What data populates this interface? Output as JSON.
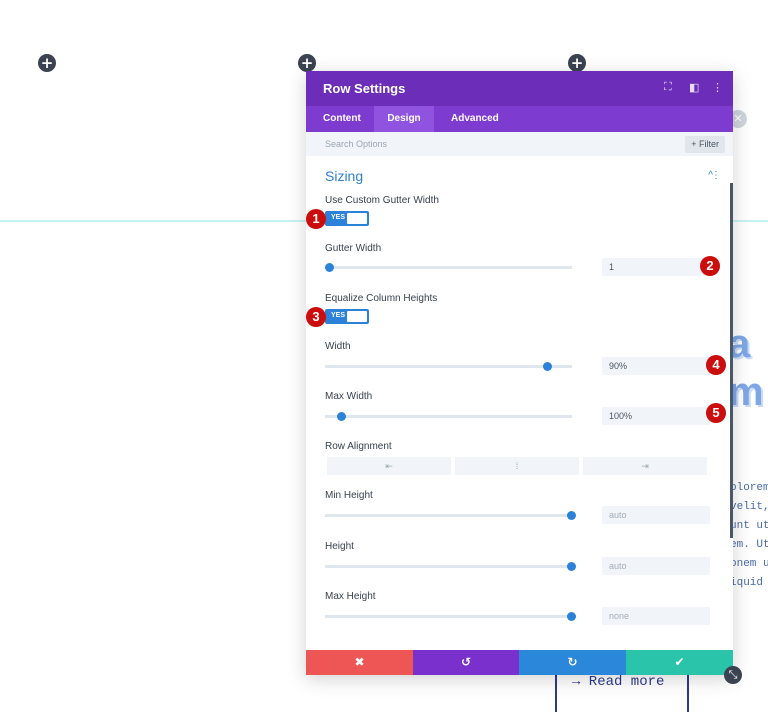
{
  "page": {
    "plus_icon": "+",
    "background_big": [
      "a",
      "m"
    ],
    "background_text": [
      "olorem",
      " velit,",
      "unt ut",
      "em. Ut",
      "onem ul",
      "iquid e"
    ],
    "read_more": "→ Read more"
  },
  "modal": {
    "title": "Row Settings",
    "header_icons": {
      "expand": "⛶",
      "split": "◧",
      "more": "⋮"
    },
    "tabs": [
      {
        "label": "Content",
        "active": false
      },
      {
        "label": "Design",
        "active": true
      },
      {
        "label": "Advanced",
        "active": false
      }
    ],
    "search_placeholder": "Search Options",
    "filter_label": "+ Filter",
    "section": {
      "title": "Sizing",
      "caret": "^",
      "dots": "⋮"
    },
    "fields": {
      "custom_gutter": {
        "label": "Use Custom Gutter Width",
        "value": "YES"
      },
      "gutter_width": {
        "label": "Gutter Width",
        "value": "1",
        "level": 0.0
      },
      "equalize": {
        "label": "Equalize Column Heights",
        "value": "YES"
      },
      "width": {
        "label": "Width",
        "value": "90%",
        "level": 0.9
      },
      "max_width": {
        "label": "Max Width",
        "value": "100%",
        "level": 0.05
      },
      "row_alignment": {
        "label": "Row Alignment",
        "options": [
          "⇤",
          "⁞",
          "⇥"
        ]
      },
      "min_height": {
        "label": "Min Height",
        "value": "auto",
        "level": 1.0
      },
      "height": {
        "label": "Height",
        "value": "auto",
        "level": 1.0
      },
      "max_height": {
        "label": "Max Height",
        "value": "none",
        "level": 1.0
      }
    },
    "markers": [
      "1",
      "2",
      "3",
      "4",
      "5"
    ],
    "footer": {
      "cancel": {
        "icon": "✖",
        "color": "#ee5655"
      },
      "undo": {
        "icon": "↺",
        "color": "#7a30cc"
      },
      "redo": {
        "icon": "↻",
        "color": "#2b87da"
      },
      "save": {
        "icon": "✔",
        "color": "#29c4a9"
      }
    }
  }
}
